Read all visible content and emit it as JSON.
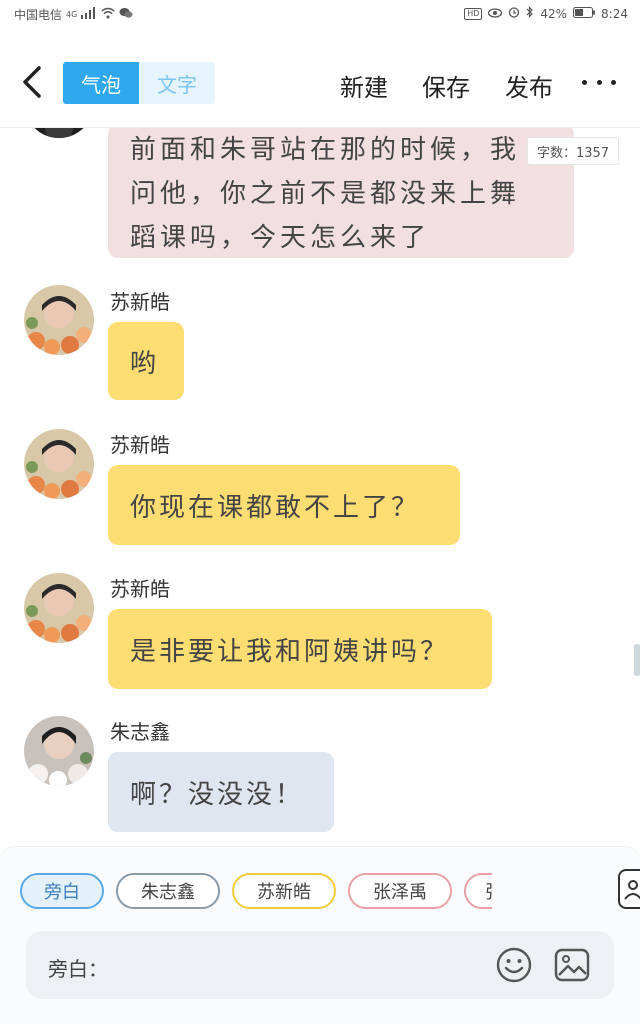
{
  "status_bar": {
    "carrier": "中国电信",
    "network": "4G",
    "hd": "HD",
    "battery": "42%",
    "time": "8:24"
  },
  "toolbar": {
    "mode_bubble": "气泡",
    "mode_text": "文字",
    "new_label": "新建",
    "save_label": "保存",
    "publish_label": "发布"
  },
  "word_count": "字数：1357",
  "messages": [
    {
      "speaker": "",
      "text_lines": [
        "前面和朱哥站在那的时候，我",
        "问他，你之前不是都没来上舞",
        "蹈课吗，今天怎么来了"
      ],
      "style": "pink"
    },
    {
      "speaker": "苏新皓",
      "text": "哟",
      "style": "yellow"
    },
    {
      "speaker": "苏新皓",
      "text": "你现在课都敢不上了？",
      "style": "yellow"
    },
    {
      "speaker": "苏新皓",
      "text": "是非要让我和阿姨讲吗？",
      "style": "yellow"
    },
    {
      "speaker": "朱志鑫",
      "text": "啊？没没没！",
      "style": "grey"
    }
  ],
  "roles": [
    "旁白",
    "朱志鑫",
    "苏新皓",
    "张泽禹",
    "张"
  ],
  "input": {
    "label": "旁白："
  },
  "colors": {
    "accent": "#2fa8f0",
    "bubble_pink": "#f2dfe0",
    "bubble_yellow": "#fedd73",
    "bubble_grey": "#dfe6f0"
  }
}
